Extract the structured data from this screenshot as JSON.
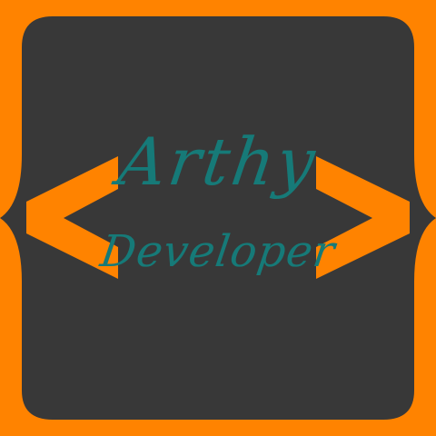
{
  "logo": {
    "name": "Arthy",
    "role": "Developer"
  },
  "colors": {
    "frame": "#ff8300",
    "panel": "#383838",
    "text": "#167a78",
    "brackets": "#ff8300"
  }
}
